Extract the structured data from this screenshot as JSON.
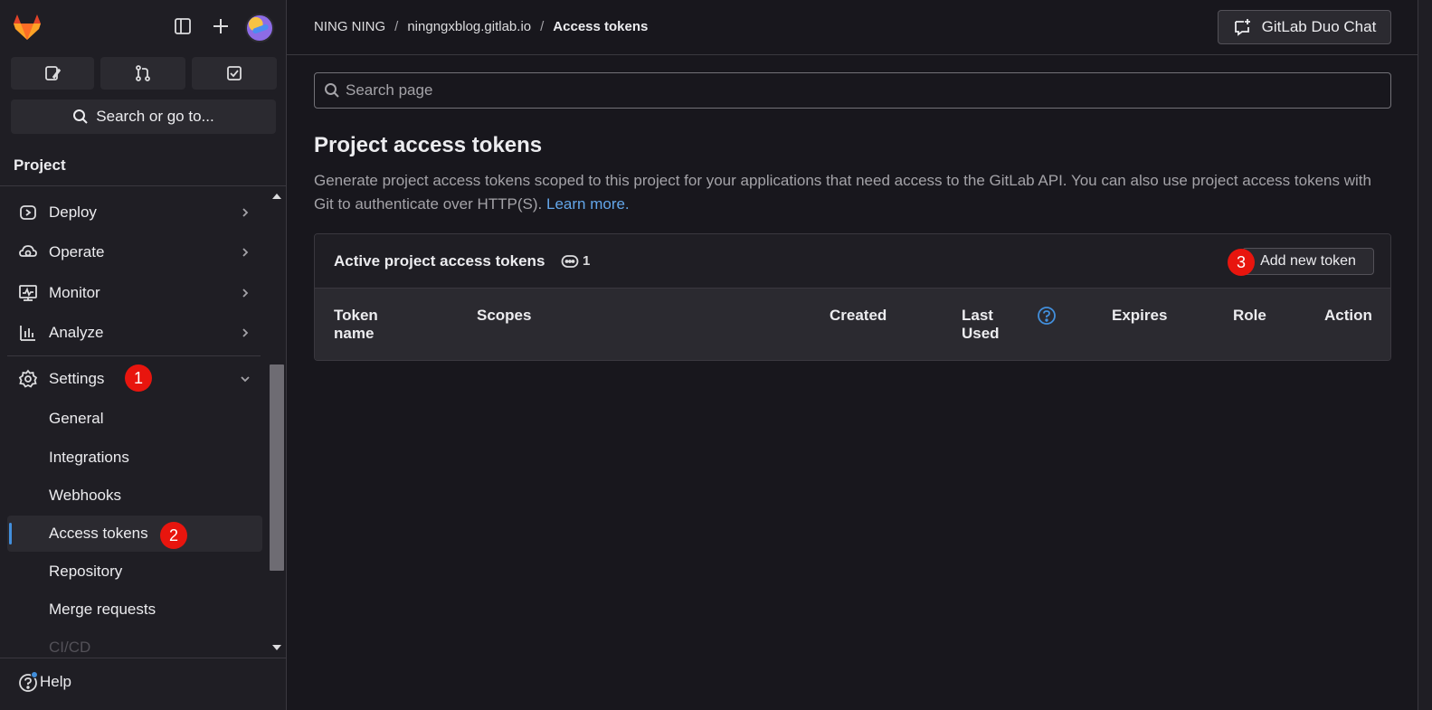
{
  "sidebar": {
    "quick_actions": [
      {
        "icon": "issues-icon"
      },
      {
        "icon": "merge-requests-icon"
      },
      {
        "icon": "todo-icon"
      }
    ],
    "search_label": "Search or go to...",
    "section_label": "Project",
    "nav": [
      {
        "label": "Deploy",
        "icon": "deploy-icon"
      },
      {
        "label": "Operate",
        "icon": "operate-icon"
      },
      {
        "label": "Monitor",
        "icon": "monitor-icon"
      },
      {
        "label": "Analyze",
        "icon": "analyze-icon"
      },
      {
        "label": "Settings",
        "icon": "settings-icon",
        "expanded": true
      }
    ],
    "settings_items": [
      {
        "label": "General"
      },
      {
        "label": "Integrations"
      },
      {
        "label": "Webhooks"
      },
      {
        "label": "Access tokens",
        "active": true
      },
      {
        "label": "Repository"
      },
      {
        "label": "Merge requests"
      },
      {
        "label": "CI/CD"
      }
    ],
    "help_label": "Help"
  },
  "annotations": {
    "badge1": "1",
    "badge2": "2",
    "badge3": "3"
  },
  "header": {
    "breadcrumbs": [
      "NING NING",
      "ningngxblog.gitlab.io",
      "Access tokens"
    ],
    "duo_chat_label": "GitLab Duo Chat"
  },
  "main": {
    "search_placeholder": "Search page",
    "title": "Project access tokens",
    "description": "Generate project access tokens scoped to this project for your applications that need access to the GitLab API. You can also use project access tokens with Git to authenticate over HTTP(S).",
    "learn_more": "Learn more.",
    "card": {
      "title": "Active project access tokens",
      "count": "1",
      "add_label": "Add new token",
      "columns": [
        "Token name",
        "Scopes",
        "Created",
        "Last Used",
        "Expires",
        "Role",
        "Action"
      ]
    }
  },
  "colors": {
    "accent": "#428fdc",
    "badge": "#e8150e",
    "background": "#18171d",
    "sidebar": "#1f1e24"
  }
}
